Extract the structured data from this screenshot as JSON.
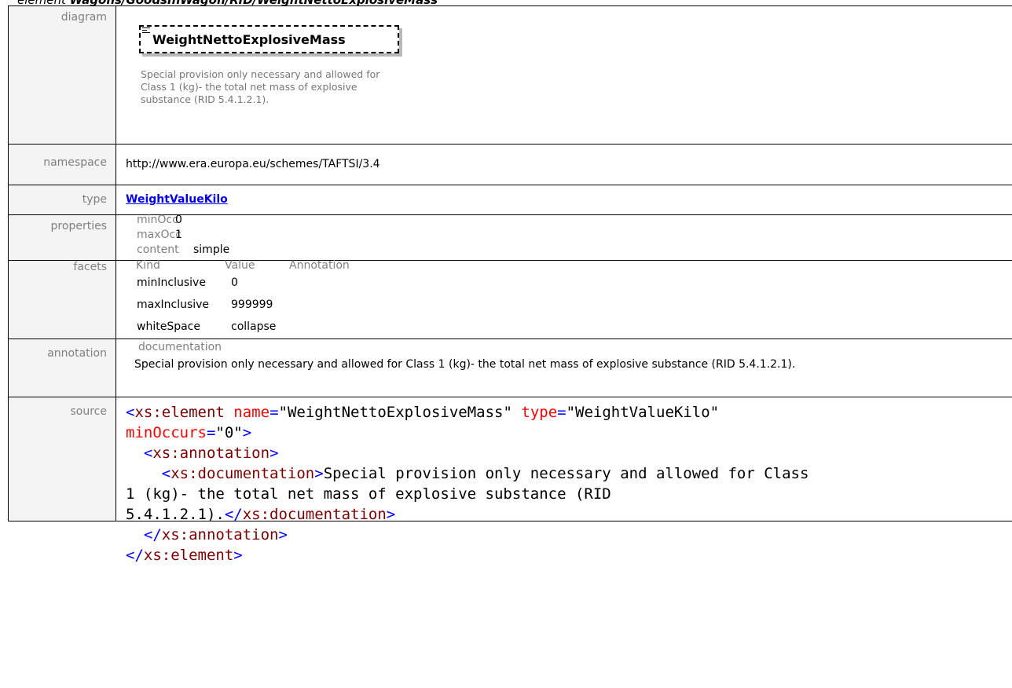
{
  "title": {
    "prefix": "element ",
    "path": "Wagons/GoodsInWagon/RID/WeightNettoExplosiveMass"
  },
  "labels": {
    "diagram": "diagram",
    "namespace": "namespace",
    "type": "type",
    "properties": "properties",
    "facets": "facets",
    "annotation": "annotation",
    "source": "source"
  },
  "diagram": {
    "element_name": "WeightNettoExplosiveMass",
    "description": "Special provision only necessary and allowed for Class 1 (kg)- the total net mass of explosive substance (RID 5.4.1.2.1)."
  },
  "namespace": "http://www.era.europa.eu/schemes/TAFTSI/3.4",
  "type": "WeightValueKilo",
  "properties": [
    {
      "key": "minOcc",
      "value": "0"
    },
    {
      "key": "maxOcc",
      "value": "1"
    },
    {
      "key": "content",
      "value": "simple"
    }
  ],
  "facets": {
    "headers": [
      "Kind",
      "Value",
      "Annotation"
    ],
    "rows": [
      {
        "kind": "minInclusive",
        "value": "0"
      },
      {
        "kind": "maxInclusive",
        "value": "999999"
      },
      {
        "kind": "whiteSpace",
        "value": "collapse"
      }
    ]
  },
  "annotation": {
    "heading": "documentation",
    "text": "Special provision only necessary and allowed for Class 1 (kg)- the total net mass of explosive substance (RID 5.4.1.2.1)."
  },
  "source": {
    "element_tag": "xs:element",
    "attr_name": "name",
    "name_value": "\"WeightNettoExplosiveMass\"",
    "attr_type": "type",
    "type_value": "\"WeightValueKilo\"",
    "attr_min": "minOccurs",
    "min_value": "\"0\"",
    "annotation_tag": "xs:annotation",
    "documentation_tag": "xs:documentation",
    "doc_text_line1": "Special provision only necessary and allowed for Class",
    "doc_text_line2": "1 (kg)- the total net mass of explosive substance (RID",
    "doc_text_line3": "5.4.1.2.1)."
  }
}
